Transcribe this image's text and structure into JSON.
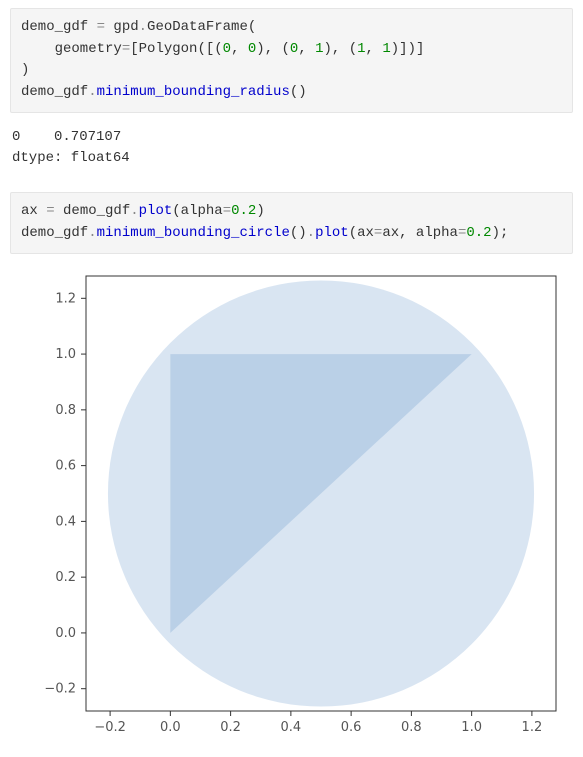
{
  "code1": {
    "l1a": "demo_gdf ",
    "l1b": "=",
    "l1c": " gpd",
    "l1d": ".",
    "l1e": "GeoDataFrame",
    "l1f": "(",
    "l2a": "    geometry",
    "l2b": "=",
    "l2c": "[",
    "l2d": "Polygon",
    "l2e": "([(",
    "l2n1": "0",
    "l2f": ", ",
    "l2n2": "0",
    "l2g": "), (",
    "l2n3": "0",
    "l2h": ", ",
    "l2n4": "1",
    "l2i": "), (",
    "l2n5": "1",
    "l2j": ", ",
    "l2n6": "1",
    "l2k": ")])]",
    "l3a": ")",
    "l4a": "demo_gdf",
    "l4b": ".",
    "l4c": "minimum_bounding_radius",
    "l4d": "()"
  },
  "output1": {
    "line1": "0    0.707107",
    "line2": "dtype: float64"
  },
  "code2": {
    "l1a": "ax ",
    "l1b": "=",
    "l1c": " demo_gdf",
    "l1d": ".",
    "l1e": "plot",
    "l1f": "(alpha",
    "l1g": "=",
    "l1h": "0.2",
    "l1i": ")",
    "l2a": "demo_gdf",
    "l2b": ".",
    "l2c": "minimum_bounding_circle",
    "l2d": "()",
    "l2e": ".",
    "l2f": "plot",
    "l2g": "(ax",
    "l2h": "=",
    "l2i": "ax, alpha",
    "l2j": "=",
    "l2k": "0.2",
    "l2l": ");"
  },
  "chart_data": {
    "type": "area",
    "title": "",
    "xlabel": "",
    "ylabel": "",
    "xlim": [
      -0.28,
      1.28
    ],
    "ylim": [
      -0.28,
      1.28
    ],
    "xticks": [
      "−0.2",
      "0.0",
      "0.2",
      "0.4",
      "0.6",
      "0.8",
      "1.0",
      "1.2"
    ],
    "yticks": [
      "−0.2",
      "0.0",
      "0.2",
      "0.4",
      "0.6",
      "0.8",
      "1.0",
      "1.2"
    ],
    "series": [
      {
        "name": "triangle",
        "type": "polygon",
        "points": [
          [
            0,
            0
          ],
          [
            0,
            1
          ],
          [
            1,
            1
          ]
        ],
        "fill": "#3f7fbf",
        "alpha": 0.2
      },
      {
        "name": "bounding-circle",
        "type": "circle",
        "cx": 0.5,
        "cy": 0.5,
        "r": 0.707107,
        "fill": "#3f7fbf",
        "alpha": 0.2
      }
    ]
  }
}
